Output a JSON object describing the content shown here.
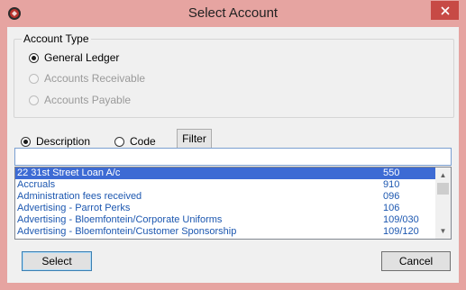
{
  "window": {
    "title": "Select Account",
    "accent": "#e6a4a1",
    "close_color": "#c74a45"
  },
  "account_type": {
    "label": "Account Type",
    "options": [
      {
        "label": "General Ledger",
        "selected": true,
        "enabled": true
      },
      {
        "label": "Accounts Receivable",
        "selected": false,
        "enabled": false
      },
      {
        "label": "Accounts Payable",
        "selected": false,
        "enabled": false
      }
    ]
  },
  "search": {
    "by_description_label": "Description",
    "by_code_label": "Code",
    "filter_label": "Filter",
    "value": "",
    "placeholder": ""
  },
  "accounts": [
    {
      "description": "22 31st Street Loan A/c",
      "code": "550"
    },
    {
      "description": "Accruals",
      "code": "910"
    },
    {
      "description": "Administration fees received",
      "code": "096"
    },
    {
      "description": "Advertising - Parrot Perks",
      "code": "106"
    },
    {
      "description": "Advertising - Bloemfontein/Corporate Uniforms",
      "code": "109/030"
    },
    {
      "description": "Advertising - Bloemfontein/Customer Sponsorship",
      "code": "109/120"
    }
  ],
  "buttons": {
    "select_label": "Select",
    "cancel_label": "Cancel"
  }
}
